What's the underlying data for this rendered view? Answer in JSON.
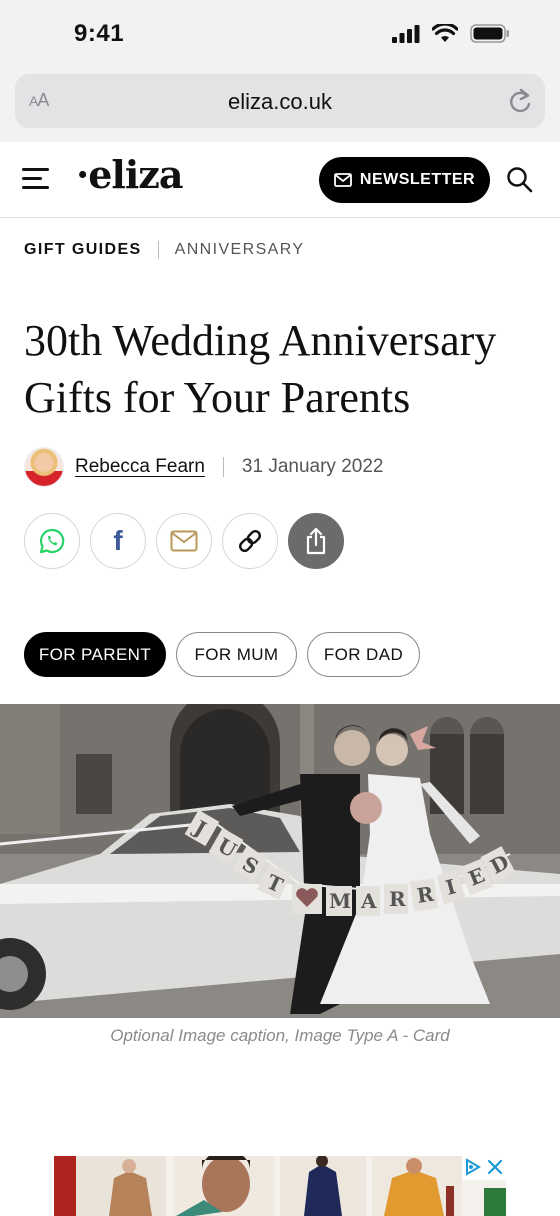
{
  "status_bar": {
    "time": "9:41"
  },
  "browser": {
    "text_size_label_small": "A",
    "text_size_label_large": "A",
    "url": "eliza.co.uk"
  },
  "header": {
    "logo": "·eliza",
    "newsletter_label": "NEWSLETTER"
  },
  "breadcrumb": {
    "section": "GIFT GUIDES",
    "subsection": "ANNIVERSARY"
  },
  "article": {
    "title": "30th Wedding Anniversary Gifts for Your Parents",
    "author": "Rebecca Fearn",
    "date": "31 January 2022",
    "image_caption": "Optional Image caption,  Image Type A - Card",
    "image_sign_letters_left": [
      "J",
      "U",
      "S",
      "T"
    ],
    "image_sign_letters_right": [
      "M",
      "A",
      "R",
      "R",
      "I",
      "E",
      "D"
    ]
  },
  "share": {
    "facebook_glyph": "f"
  },
  "filters": [
    {
      "label": "FOR PARENT",
      "active": true
    },
    {
      "label": "FOR MUM",
      "active": false
    },
    {
      "label": "FOR DAD",
      "active": false
    }
  ],
  "colors": {
    "brand_black": "#000000",
    "whatsapp_green": "#25d366",
    "facebook_blue": "#3b5998",
    "mail_gold": "#b89a5a",
    "ad_blue": "#1a9bd7"
  }
}
